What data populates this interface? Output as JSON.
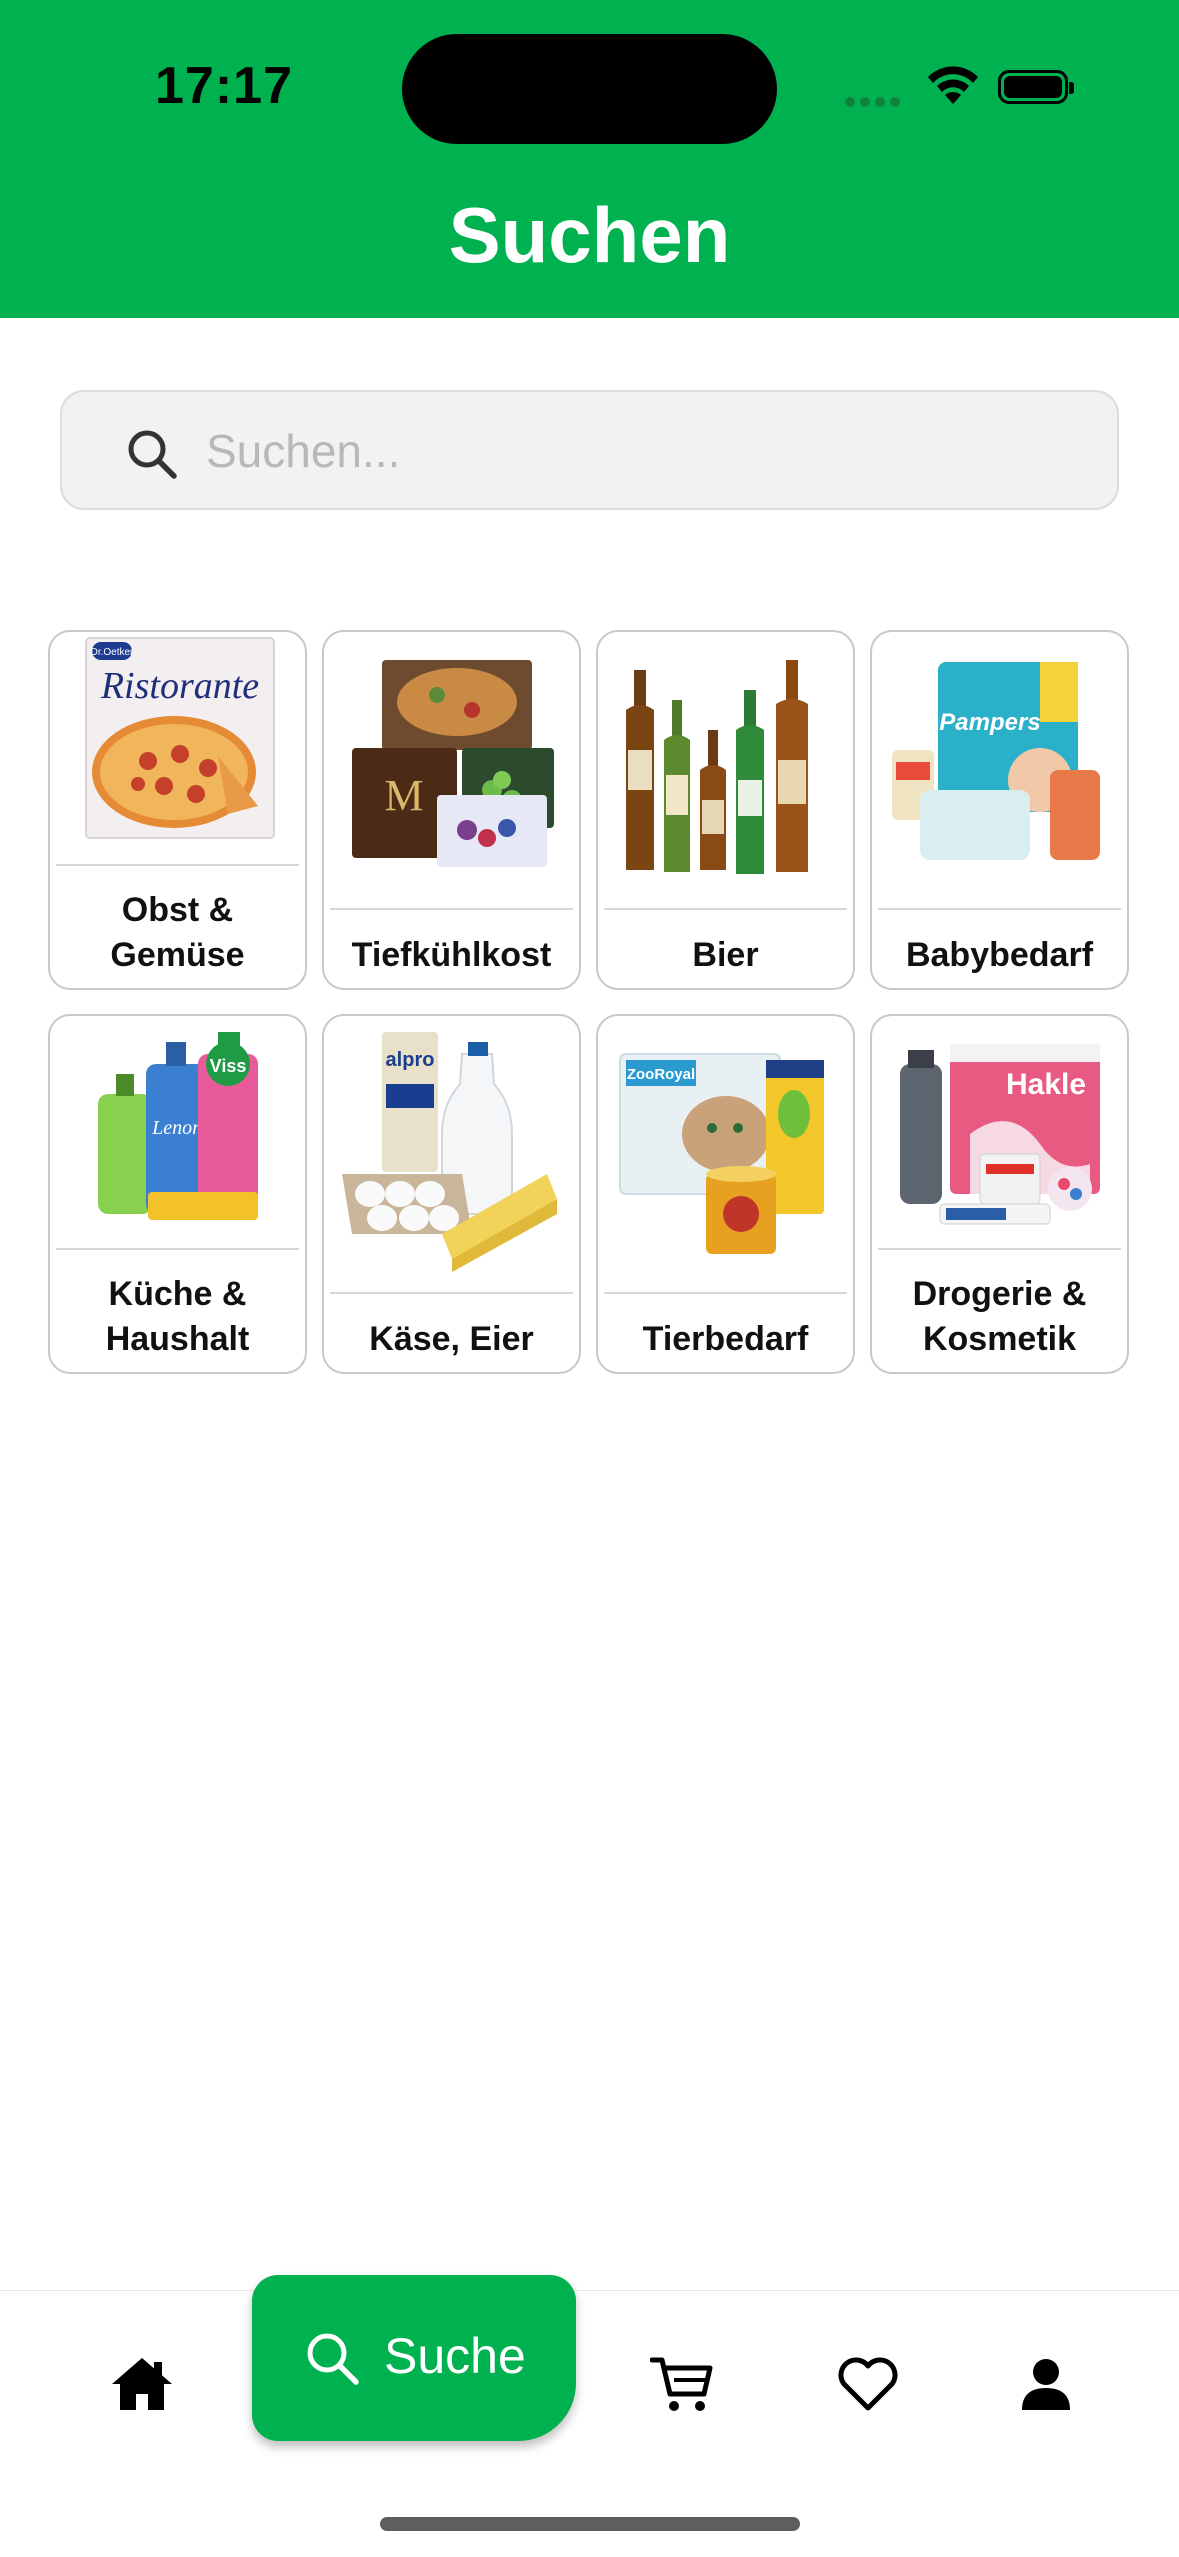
{
  "status_bar": {
    "time": "17:17"
  },
  "header": {
    "title": "Suchen",
    "background_color": "#00b14f"
  },
  "search": {
    "placeholder": "Suchen...",
    "value": ""
  },
  "categories": [
    {
      "label_line1": "Obst &",
      "label_line2": "Gemüse",
      "image": "pizza-ristorante-image",
      "image_text": "Ristorante"
    },
    {
      "label_line1": "",
      "label_line2": "Tiefkühlkost",
      "image": "frozen-food-image"
    },
    {
      "label_line1": "",
      "label_line2": "Bier",
      "image": "beer-bottles-image"
    },
    {
      "label_line1": "",
      "label_line2": "Babybedarf",
      "image": "baby-products-image",
      "image_text": "Pampers"
    },
    {
      "label_line1": "Küche &",
      "label_line2": "Haushalt",
      "image": "cleaning-products-image",
      "image_text": "Viss"
    },
    {
      "label_line1": "",
      "label_line2": "Käse, Eier",
      "image": "dairy-eggs-image",
      "image_text": "alpro"
    },
    {
      "label_line1": "",
      "label_line2": "Tierbedarf",
      "image": "pet-supplies-image",
      "image_text": "ZooRoyal"
    },
    {
      "label_line1": "Drogerie &",
      "label_line2": "Kosmetik",
      "image": "drugstore-image",
      "image_text": "Hakle"
    }
  ],
  "tabbar": {
    "items": [
      {
        "icon": "home-icon",
        "active": false
      },
      {
        "icon": "search-icon",
        "label": "Suche",
        "active": true
      },
      {
        "icon": "cart-icon",
        "active": false
      },
      {
        "icon": "heart-icon",
        "active": false
      },
      {
        "icon": "person-icon",
        "active": false
      }
    ],
    "active_color": "#00b14f"
  }
}
